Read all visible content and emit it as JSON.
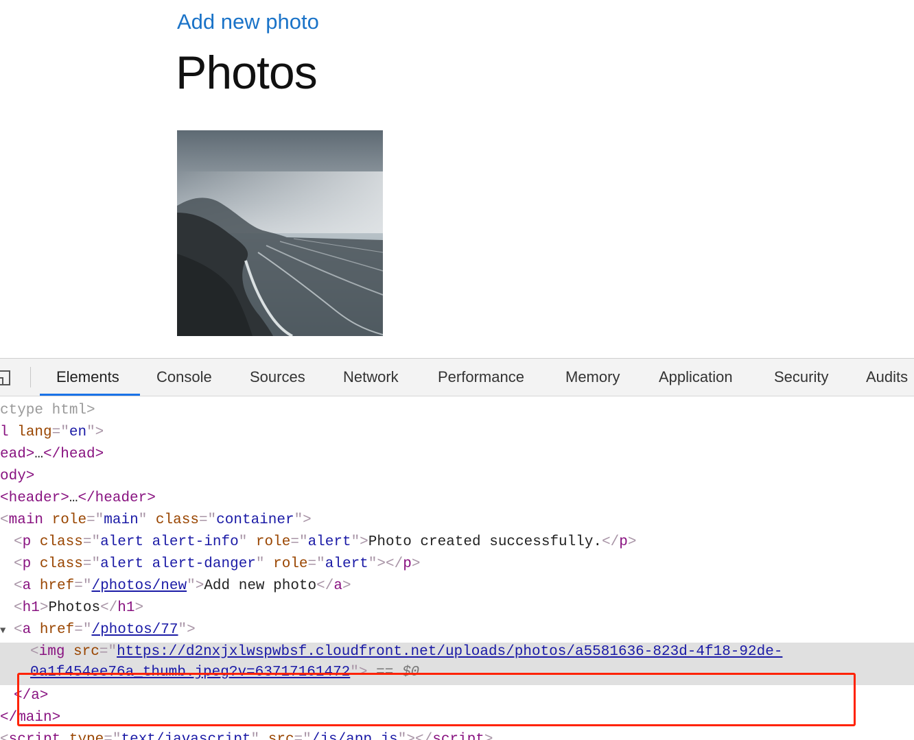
{
  "page": {
    "add_link": "Add new photo",
    "title": "Photos"
  },
  "devtools": {
    "tabs": [
      "Elements",
      "Console",
      "Sources",
      "Network",
      "Performance",
      "Memory",
      "Application",
      "Security",
      "Audits"
    ],
    "active_tab": "Elements",
    "tree": {
      "doctype": "ctype html>",
      "html_tag": "l",
      "html_attr": "lang",
      "html_val": "en",
      "head_open": "ead>",
      "ellipsis": "…",
      "head_close": "</head>",
      "body": "ody>",
      "header_open": "<header>",
      "header_close": "</header>",
      "main_tag": "main",
      "main_role_attr": "role",
      "main_role_val": "main",
      "main_class_attr": "class",
      "main_class_val": "container",
      "p_tag": "p",
      "class_attr": "class",
      "role_attr": "role",
      "alert_info_val": "alert alert-info",
      "alert_val": "alert",
      "alert_info_text": "Photo created successfully.",
      "alert_danger_val": "alert alert-danger",
      "a_tag": "a",
      "href_attr": "href",
      "new_href": "/photos/new",
      "new_text": "Add new photo",
      "h1_tag": "h1",
      "h1_text": "Photos",
      "photo_href": "/photos/77",
      "img_tag": "img",
      "src_attr": "src",
      "img_src_line1": "https://d2nxjxlwspwbsf.cloudfront.net/uploads/photos/a5581636-823d-4f18-92de-",
      "img_src_line2": "0a1f454ee76a_thumb.jpeg?v=63717161472",
      "eq": "==",
      "dollar": "$0",
      "a_close": "</a>",
      "main_close": "</main>",
      "script_tag": "script",
      "type_attr": "type",
      "script_type_val": "text/javascript",
      "script_src_val": "/js/app.js"
    }
  },
  "colors": {
    "link": "#1a73c8",
    "tab_active_underline": "#1a73e8",
    "highlight_box": "#ff2200",
    "tag": "#881280",
    "attr": "#994500",
    "value": "#1a1aa6"
  }
}
